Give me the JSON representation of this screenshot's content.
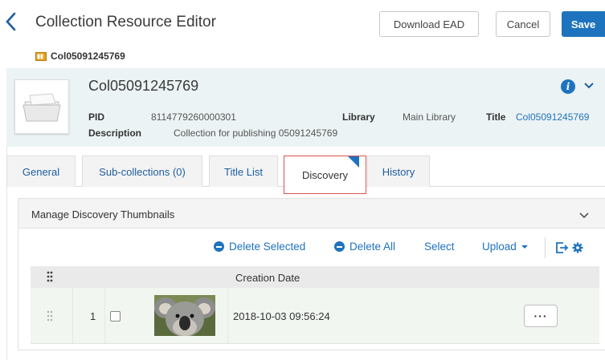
{
  "header": {
    "back_icon": "chevron-left-icon",
    "title": "Collection Resource Editor",
    "download_label": "Download EAD",
    "cancel_label": "Cancel",
    "save_label": "Save"
  },
  "breadcrumb": {
    "icon": "collection-folder-icon",
    "label": "Col05091245769"
  },
  "info": {
    "name": "Col05091245769",
    "pid_label": "PID",
    "pid_value": "8114779260000301",
    "library_label": "Library",
    "library_value": "Main Library",
    "title_label": "Title",
    "title_value": "Col05091245769",
    "description_label": "Description",
    "description_value": "Collection for publishing 05091245769"
  },
  "tabs": [
    {
      "label": "General"
    },
    {
      "label": "Sub-collections (0)"
    },
    {
      "label": "Title List"
    },
    {
      "label": "Discovery"
    },
    {
      "label": "History"
    }
  ],
  "section": {
    "title": "Manage Discovery Thumbnails"
  },
  "toolbar": {
    "delete_selected": "Delete Selected",
    "delete_all": "Delete All",
    "select": "Select",
    "upload": "Upload"
  },
  "table": {
    "header": "Creation Date",
    "rows": [
      {
        "index": "1",
        "creation_date": "2018-10-03 09:56:24"
      }
    ],
    "row_menu_label": "···"
  },
  "colors": {
    "accent": "#1e73be",
    "panel": "#ecf3f4",
    "active_tab_border": "#d9534f",
    "row_bg": "#f1f6f1"
  }
}
